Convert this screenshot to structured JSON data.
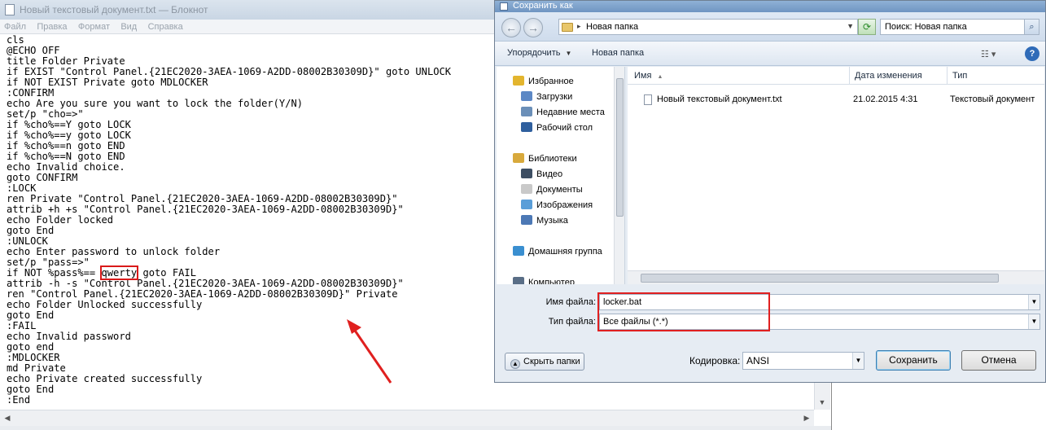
{
  "notepad": {
    "title": "Новый текстовый документ.txt — Блокнот",
    "menu": [
      "Файл",
      "Правка",
      "Формат",
      "Вид",
      "Справка"
    ],
    "lines": [
      "cls",
      "@ECHO OFF",
      "title Folder Private",
      "if EXIST \"Control Panel.{21EC2020-3AEA-1069-A2DD-08002B30309D}\" goto UNLOCK",
      "if NOT EXIST Private goto MDLOCKER",
      ":CONFIRM",
      "echo Are you sure you want to lock the folder(Y/N)",
      "set/p \"cho=>\"",
      "if %cho%==Y goto LOCK",
      "if %cho%==y goto LOCK",
      "if %cho%==n goto END",
      "if %cho%==N goto END",
      "echo Invalid choice.",
      "goto CONFIRM",
      ":LOCK",
      "ren Private \"Control Panel.{21EC2020-3AEA-1069-A2DD-08002B30309D}\"",
      "attrib +h +s \"Control Panel.{21EC2020-3AEA-1069-A2DD-08002B30309D}\"",
      "echo Folder locked",
      "goto End",
      ":UNLOCK",
      "echo Enter password to unlock folder",
      "set/p \"pass=>\"",
      "",
      "attrib -h -s \"Control Panel.{21EC2020-3AEA-1069-A2DD-08002B30309D}\"",
      "ren \"Control Panel.{21EC2020-3AEA-1069-A2DD-08002B30309D}\" Private",
      "echo Folder Unlocked successfully",
      "goto End",
      ":FAIL",
      "echo Invalid password",
      "goto end",
      ":MDLOCKER",
      "md Private",
      "echo Private created successfully",
      "goto End",
      ":End"
    ],
    "password_line": {
      "before": "if NOT %pass%== ",
      "password": "qwerty",
      "after": " goto FAIL"
    }
  },
  "dialog": {
    "title": "Сохранить как",
    "address_path": "Новая папка",
    "search_placeholder": "Поиск: Новая папка",
    "toolbar": {
      "organize": "Упорядочить",
      "new_folder": "Новая папка"
    },
    "nav": [
      {
        "label": "Избранное",
        "icon": "star-icon",
        "indent": 0,
        "color": "#e3b52e"
      },
      {
        "label": "Загрузки",
        "icon": "downloads-folder-icon",
        "indent": 1,
        "color": "#5c88c5"
      },
      {
        "label": "Недавние места",
        "icon": "recent-places-icon",
        "indent": 1,
        "color": "#6b8fb8"
      },
      {
        "label": "Рабочий стол",
        "icon": "desktop-icon",
        "indent": 1,
        "color": "#2f5f9e"
      },
      {
        "label": "",
        "icon": "",
        "indent": 0,
        "color": ""
      },
      {
        "label": "Библиотеки",
        "icon": "libraries-icon",
        "indent": 0,
        "color": "#d8a93c"
      },
      {
        "label": "Видео",
        "icon": "video-icon",
        "indent": 1,
        "color": "#3d4e63"
      },
      {
        "label": "Документы",
        "icon": "documents-icon",
        "indent": 1,
        "color": "#c9c9c9"
      },
      {
        "label": "Изображения",
        "icon": "images-icon",
        "indent": 1,
        "color": "#5a9ed8"
      },
      {
        "label": "Музыка",
        "icon": "music-icon",
        "indent": 1,
        "color": "#4c78b5"
      },
      {
        "label": "",
        "icon": "",
        "indent": 0,
        "color": ""
      },
      {
        "label": "Домашняя группа",
        "icon": "homegroup-icon",
        "indent": 0,
        "color": "#3a8fd0"
      },
      {
        "label": "",
        "icon": "",
        "indent": 0,
        "color": ""
      },
      {
        "label": "Компьютер",
        "icon": "computer-icon",
        "indent": 0,
        "color": "#5a6e86"
      }
    ],
    "columns": {
      "name": "Имя",
      "date": "Дата изменения",
      "type": "Тип"
    },
    "files": [
      {
        "name": "Новый текстовый документ.txt",
        "date": "21.02.2015 4:31",
        "type": "Текстовый документ"
      }
    ],
    "filename_label": "Имя файла:",
    "filename_value": "locker.bat",
    "filetype_label": "Тип файла:",
    "filetype_value": "Все файлы  (*.*)",
    "hide_folders": "Скрыть папки",
    "encoding_label": "Кодировка:",
    "encoding_value": "ANSI",
    "save": "Сохранить",
    "cancel": "Отмена"
  },
  "colors": {
    "highlight_red": "#e02020",
    "arrow_red": "#e0201f"
  }
}
